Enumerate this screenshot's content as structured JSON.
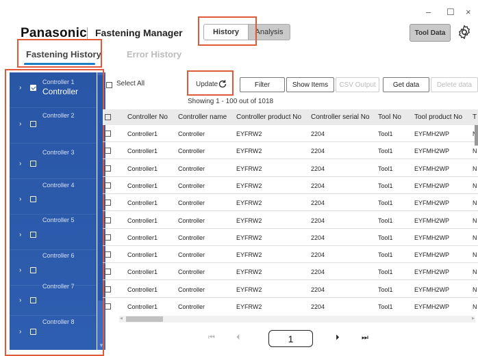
{
  "window": {
    "minimize": "–",
    "maximize": "☐",
    "close": "×"
  },
  "header": {
    "brand": "Panasonic",
    "app_title": "Fastening Manager",
    "seg_history": "History",
    "seg_analysis": "Analysis",
    "tool_data": "Tool Data",
    "settings_icon": "gear-icon"
  },
  "tabs": {
    "active": "Fastening History",
    "inactive": "Error History"
  },
  "sidebar": {
    "items": [
      {
        "label": "Controller 1",
        "sub": "Controller",
        "checked": true
      },
      {
        "label": "Controller 2",
        "sub": "",
        "checked": false
      },
      {
        "label": "Controller 3",
        "sub": "",
        "checked": false
      },
      {
        "label": "Controller 4",
        "sub": "",
        "checked": false
      },
      {
        "label": "Controller 5",
        "sub": "",
        "checked": false
      },
      {
        "label": "Controller 6",
        "sub": "",
        "checked": false
      },
      {
        "label": "Controller 7",
        "sub": "",
        "checked": false
      },
      {
        "label": "Controller 8",
        "sub": "",
        "checked": false
      }
    ]
  },
  "toolbar": {
    "select_all": "Select All",
    "update": "Update",
    "filter": "Filter",
    "show_items": "Show Items",
    "csv_output": "CSV Output",
    "get_data": "Get data",
    "delete_data": "Delete data",
    "showing": "Showing 1 - 100 out of 1018"
  },
  "table": {
    "columns": [
      "Controller No",
      "Controller name",
      "Controller product No",
      "Controller serial No",
      "Tool No",
      "Tool product No",
      "T"
    ],
    "rows": [
      [
        "Controller1",
        "Controller",
        "EYFRW2",
        "2204",
        "Tool1",
        "EYFMH2WP",
        "N"
      ],
      [
        "Controller1",
        "Controller",
        "EYFRW2",
        "2204",
        "Tool1",
        "EYFMH2WP",
        "N"
      ],
      [
        "Controller1",
        "Controller",
        "EYFRW2",
        "2204",
        "Tool1",
        "EYFMH2WP",
        "N"
      ],
      [
        "Controller1",
        "Controller",
        "EYFRW2",
        "2204",
        "Tool1",
        "EYFMH2WP",
        "N"
      ],
      [
        "Controller1",
        "Controller",
        "EYFRW2",
        "2204",
        "Tool1",
        "EYFMH2WP",
        "N"
      ],
      [
        "Controller1",
        "Controller",
        "EYFRW2",
        "2204",
        "Tool1",
        "EYFMH2WP",
        "N"
      ],
      [
        "Controller1",
        "Controller",
        "EYFRW2",
        "2204",
        "Tool1",
        "EYFMH2WP",
        "N"
      ],
      [
        "Controller1",
        "Controller",
        "EYFRW2",
        "2204",
        "Tool1",
        "EYFMH2WP",
        "N"
      ],
      [
        "Controller1",
        "Controller",
        "EYFRW2",
        "2204",
        "Tool1",
        "EYFMH2WP",
        "N"
      ],
      [
        "Controller1",
        "Controller",
        "EYFRW2",
        "2204",
        "Tool1",
        "EYFMH2WP",
        "N"
      ],
      [
        "Controller1",
        "Controller",
        "EYFRW2",
        "2204",
        "Tool1",
        "EYFMH2WP",
        "N"
      ]
    ]
  },
  "pagination": {
    "first": "⏮",
    "prev": "⏴",
    "page": "1",
    "next": "⏵",
    "last": "⏭"
  },
  "colors": {
    "accent": "#1a7fc4",
    "sidebar": "#2a56a6",
    "highlight": "#e05a3a"
  }
}
